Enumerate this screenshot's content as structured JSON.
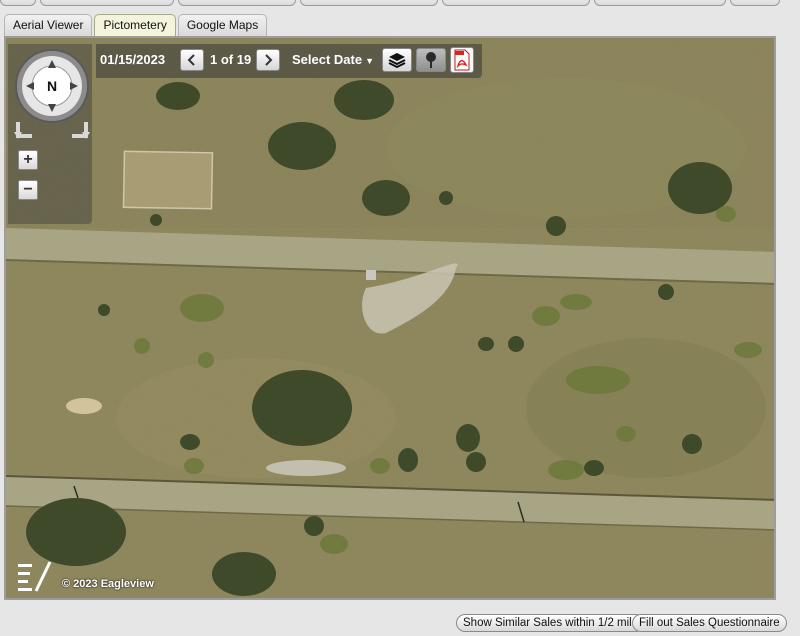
{
  "tabs": [
    {
      "label": "Aerial Viewer",
      "active": false
    },
    {
      "label": "Pictometery",
      "active": true
    },
    {
      "label": "Google Maps",
      "active": false
    }
  ],
  "toolbar": {
    "date": "01/15/2023",
    "count": "1 of 19",
    "select_date": "Select Date",
    "prev_icon": "chevron-left-icon",
    "next_icon": "chevron-right-icon",
    "layers_icon": "layers-icon",
    "info_icon": "info-pin-icon",
    "pdf_icon": "pdf-icon"
  },
  "map_controls": {
    "compass_label": "N",
    "zoom_in": "+",
    "zoom_out": "−"
  },
  "footer": {
    "copyright": "© 2023 Eagleview"
  },
  "buttons": {
    "similar_sales": "Show Similar Sales within 1/2 mile",
    "sales_questionnaire": "Fill out Sales Questionnaire"
  },
  "colors": {
    "terrain": "#8a8358",
    "road": "#a8a585",
    "tree": "#3f4a2a",
    "active_tab": "#f4f4dc"
  }
}
